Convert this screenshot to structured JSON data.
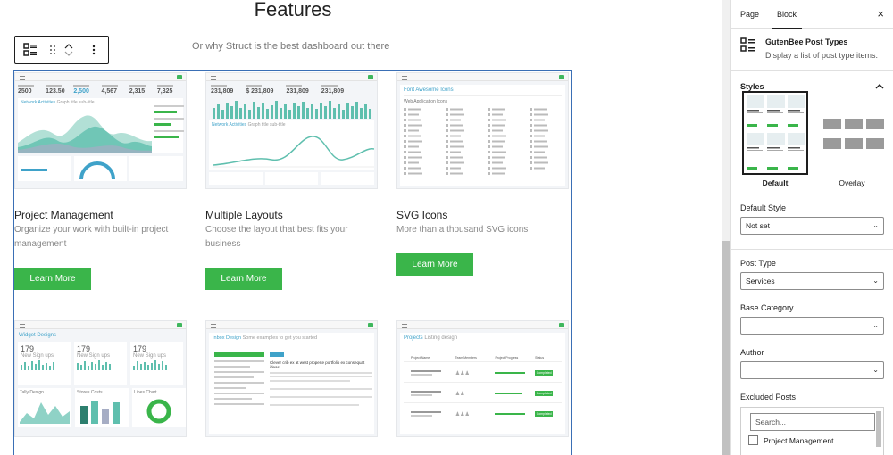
{
  "editor": {
    "section_title": "Features",
    "section_subtitle": "Or why Struct is the best dashboard out there",
    "cards": [
      {
        "title": "Project Management",
        "description": "Organize your work with built-in project management",
        "button": "Learn More"
      },
      {
        "title": "Multiple Layouts",
        "description": "Choose the layout that best fits your business",
        "button": "Learn More"
      },
      {
        "title": "SVG Icons",
        "description": "More than a thousand SVG icons",
        "button": "Learn More"
      },
      {
        "title": "",
        "description": "",
        "button": ""
      },
      {
        "title": "",
        "description": "",
        "button": ""
      },
      {
        "title": "",
        "description": "",
        "button": ""
      }
    ],
    "thumbs": {
      "t1": {
        "stats": [
          "2500",
          "123.50",
          "2,500",
          "4,567",
          "2,315",
          "7,325"
        ],
        "chart_title": "Network Activities",
        "chart_sub": "Graph title sub-title"
      },
      "t2": {
        "stats": [
          "231,809",
          "$ 231,809",
          "231,809",
          "231,809"
        ],
        "chart_title": "Network Activities",
        "chart_sub": "Graph title sub-title"
      },
      "t3": {
        "title": "Font Awesome Icons",
        "sub": "Web Application Icons"
      },
      "t4": {
        "title": "Widget Designs",
        "stats": [
          "179",
          "179",
          "179"
        ],
        "stat_label": "New Sign ups",
        "panels": [
          "Tally Design",
          "Stores Costs",
          "Lines Chart"
        ]
      },
      "t5": {
        "title": "Inbox Design",
        "sub": "Some examples to get you started",
        "heading": "Clever crib ex at west properte portfolio ex consequat ideas."
      },
      "t6": {
        "title": "Projects",
        "sub": "Listing design",
        "cols": [
          "Project Name",
          "Team Members",
          "Project Progress",
          "Status"
        ],
        "status": "Completed"
      }
    }
  },
  "sidebar": {
    "tabs": [
      "Page",
      "Block"
    ],
    "close_label": "×",
    "block_name": "GutenBee Post Types",
    "block_desc": "Display a list of post type items.",
    "styles_label": "Styles",
    "style_default": "Default",
    "style_overlay": "Overlay",
    "default_style_label": "Default Style",
    "default_style_value": "Not set",
    "post_type_label": "Post Type",
    "post_type_value": "Services",
    "base_category_label": "Base Category",
    "base_category_value": "",
    "author_label": "Author",
    "author_value": "",
    "excluded_label": "Excluded Posts",
    "search_placeholder": "Search...",
    "excluded_items": [
      "Project Management"
    ]
  },
  "colors": {
    "accent_green": "#3ab54a",
    "frame_blue": "#3a6fb5",
    "teal": "#5fbfae",
    "dark": "#1e1e1e"
  }
}
